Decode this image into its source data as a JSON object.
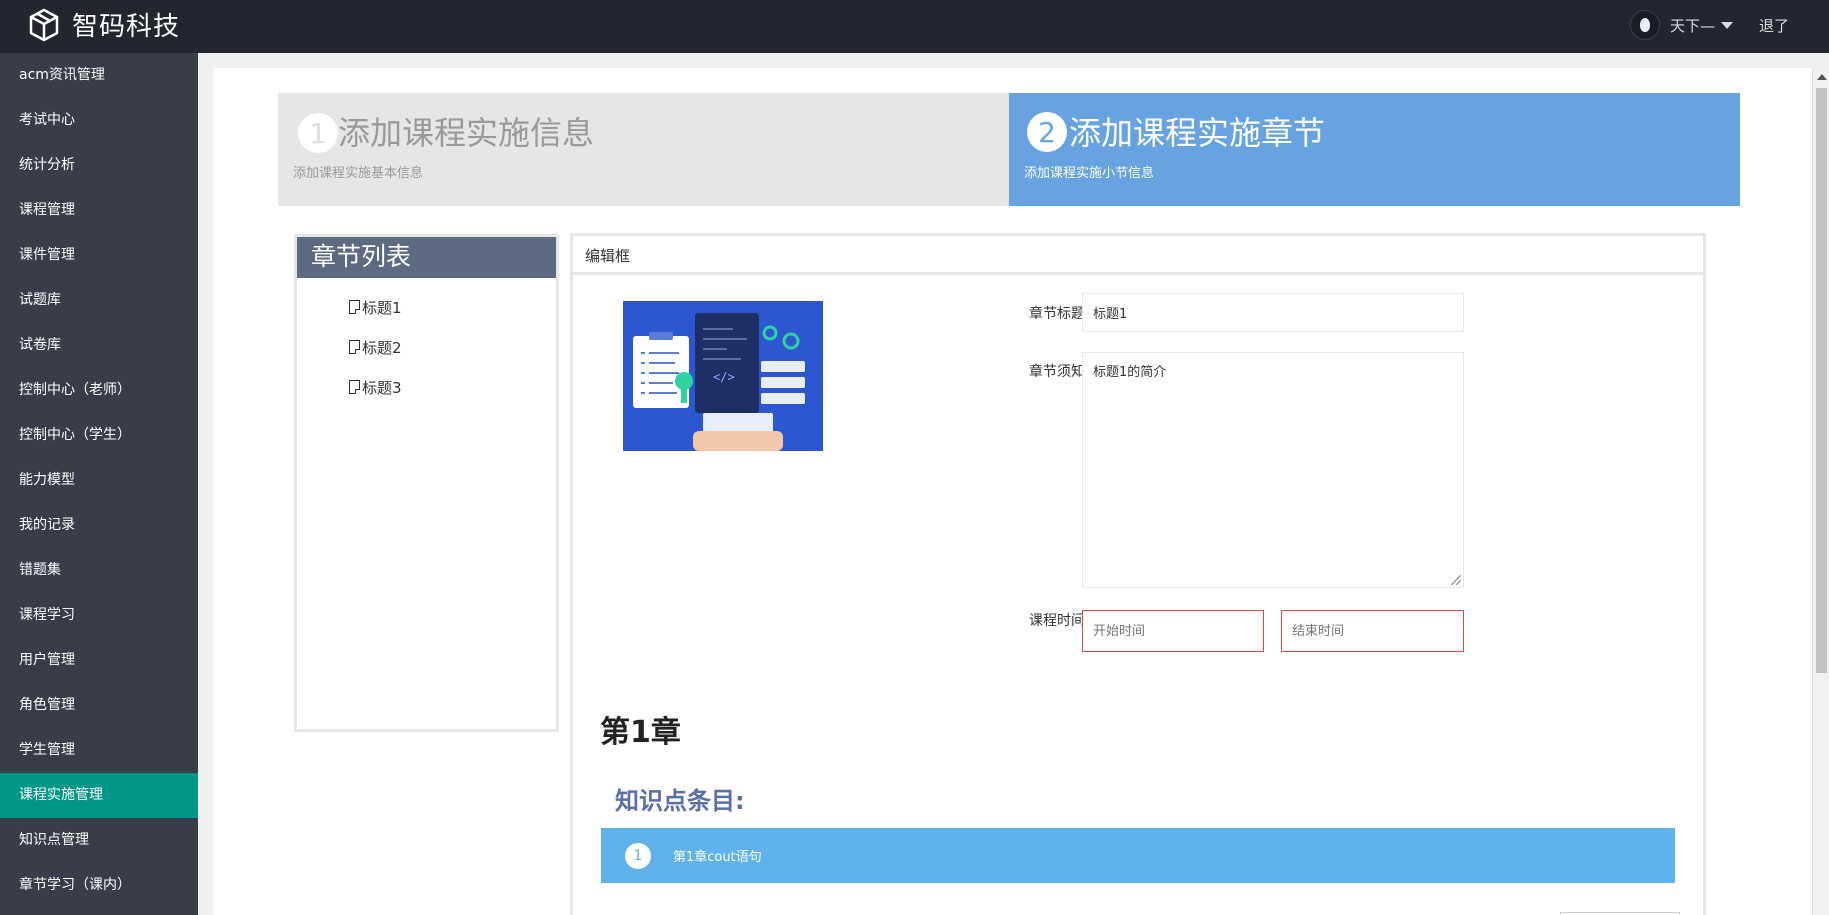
{
  "header": {
    "brand": "智码科技",
    "username": "天下—",
    "logout": "退了"
  },
  "sidebar": {
    "items": [
      {
        "label": "acm资讯管理"
      },
      {
        "label": "考试中心"
      },
      {
        "label": "统计分析"
      },
      {
        "label": "课程管理"
      },
      {
        "label": "课件管理"
      },
      {
        "label": "试题库"
      },
      {
        "label": "试卷库"
      },
      {
        "label": "控制中心（老师）"
      },
      {
        "label": "控制中心（学生）"
      },
      {
        "label": "能力模型"
      },
      {
        "label": "我的记录"
      },
      {
        "label": "错题集"
      },
      {
        "label": "课程学习"
      },
      {
        "label": "用户管理"
      },
      {
        "label": "角色管理"
      },
      {
        "label": "学生管理"
      },
      {
        "label": "课程实施管理",
        "active": true
      },
      {
        "label": "知识点管理"
      },
      {
        "label": "章节学习（课内）"
      }
    ]
  },
  "steps": [
    {
      "number": "1",
      "title": "添加课程实施信息",
      "subtitle": "添加课程实施基本信息"
    },
    {
      "number": "2",
      "title": "添加课程实施章节",
      "subtitle": "添加课程实施小节信息"
    }
  ],
  "chapter_list": {
    "title": "章节列表",
    "items": [
      "标题1",
      "标题2",
      "标题3"
    ]
  },
  "editor": {
    "title": "编辑框",
    "chapter_title_label": "章节标题",
    "chapter_title_value": "标题1",
    "chapter_notice_label": "章节须知",
    "chapter_notice_value": "标题1的简介",
    "course_time_label": "课程时间",
    "start_placeholder": "开始时间",
    "end_placeholder": "结束时间"
  },
  "chapter": {
    "heading": "第1章",
    "knowledge_title": "知识点条目:",
    "knowledge_items": [
      {
        "number": "1",
        "text": "第1章cout语句"
      }
    ]
  },
  "colors": {
    "topbar": "#23262e",
    "sidebar": "#393d49",
    "sidebar_active": "#009688",
    "step_active": "#67a3e0",
    "knowledge_row": "#5fb2ec",
    "invalid_border": "#e9464a"
  }
}
